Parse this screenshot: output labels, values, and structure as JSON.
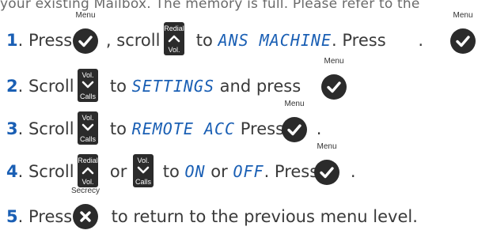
{
  "cut_top_text": "your existing Mailbox. The memory is full. Please refer to the",
  "buttons": {
    "menu_caption": "Menu",
    "secrecy_caption": "Secrecy",
    "redial_label": "Redial",
    "vol_label": "Vol.",
    "calls_label": "Calls"
  },
  "steps": [
    {
      "num": "1",
      "t1": ". Press ",
      "t2": ", scroll ",
      "t3": " to ",
      "lcd": "ANS MACHINE",
      "t4": ". Press ",
      "t5": "."
    },
    {
      "num": "2",
      "t1": ". Scroll ",
      "t2": " to ",
      "lcd": "SETTINGS",
      "t3": " and press ",
      "t4": "."
    },
    {
      "num": "3",
      "t1": ". Scroll ",
      "t2": " to ",
      "lcd": "REMOTE ACC",
      "t3": " Press ",
      "t4": "."
    },
    {
      "num": "4",
      "t1": ". Scroll ",
      "t2": " or ",
      "t3": " to ",
      "lcd1": "ON",
      "t4": " or ",
      "lcd2": "OFF",
      "t5": ". Press ",
      "t6": "."
    },
    {
      "num": "5",
      "t1": ". Press ",
      "t2": " to return to the previous menu level."
    }
  ]
}
